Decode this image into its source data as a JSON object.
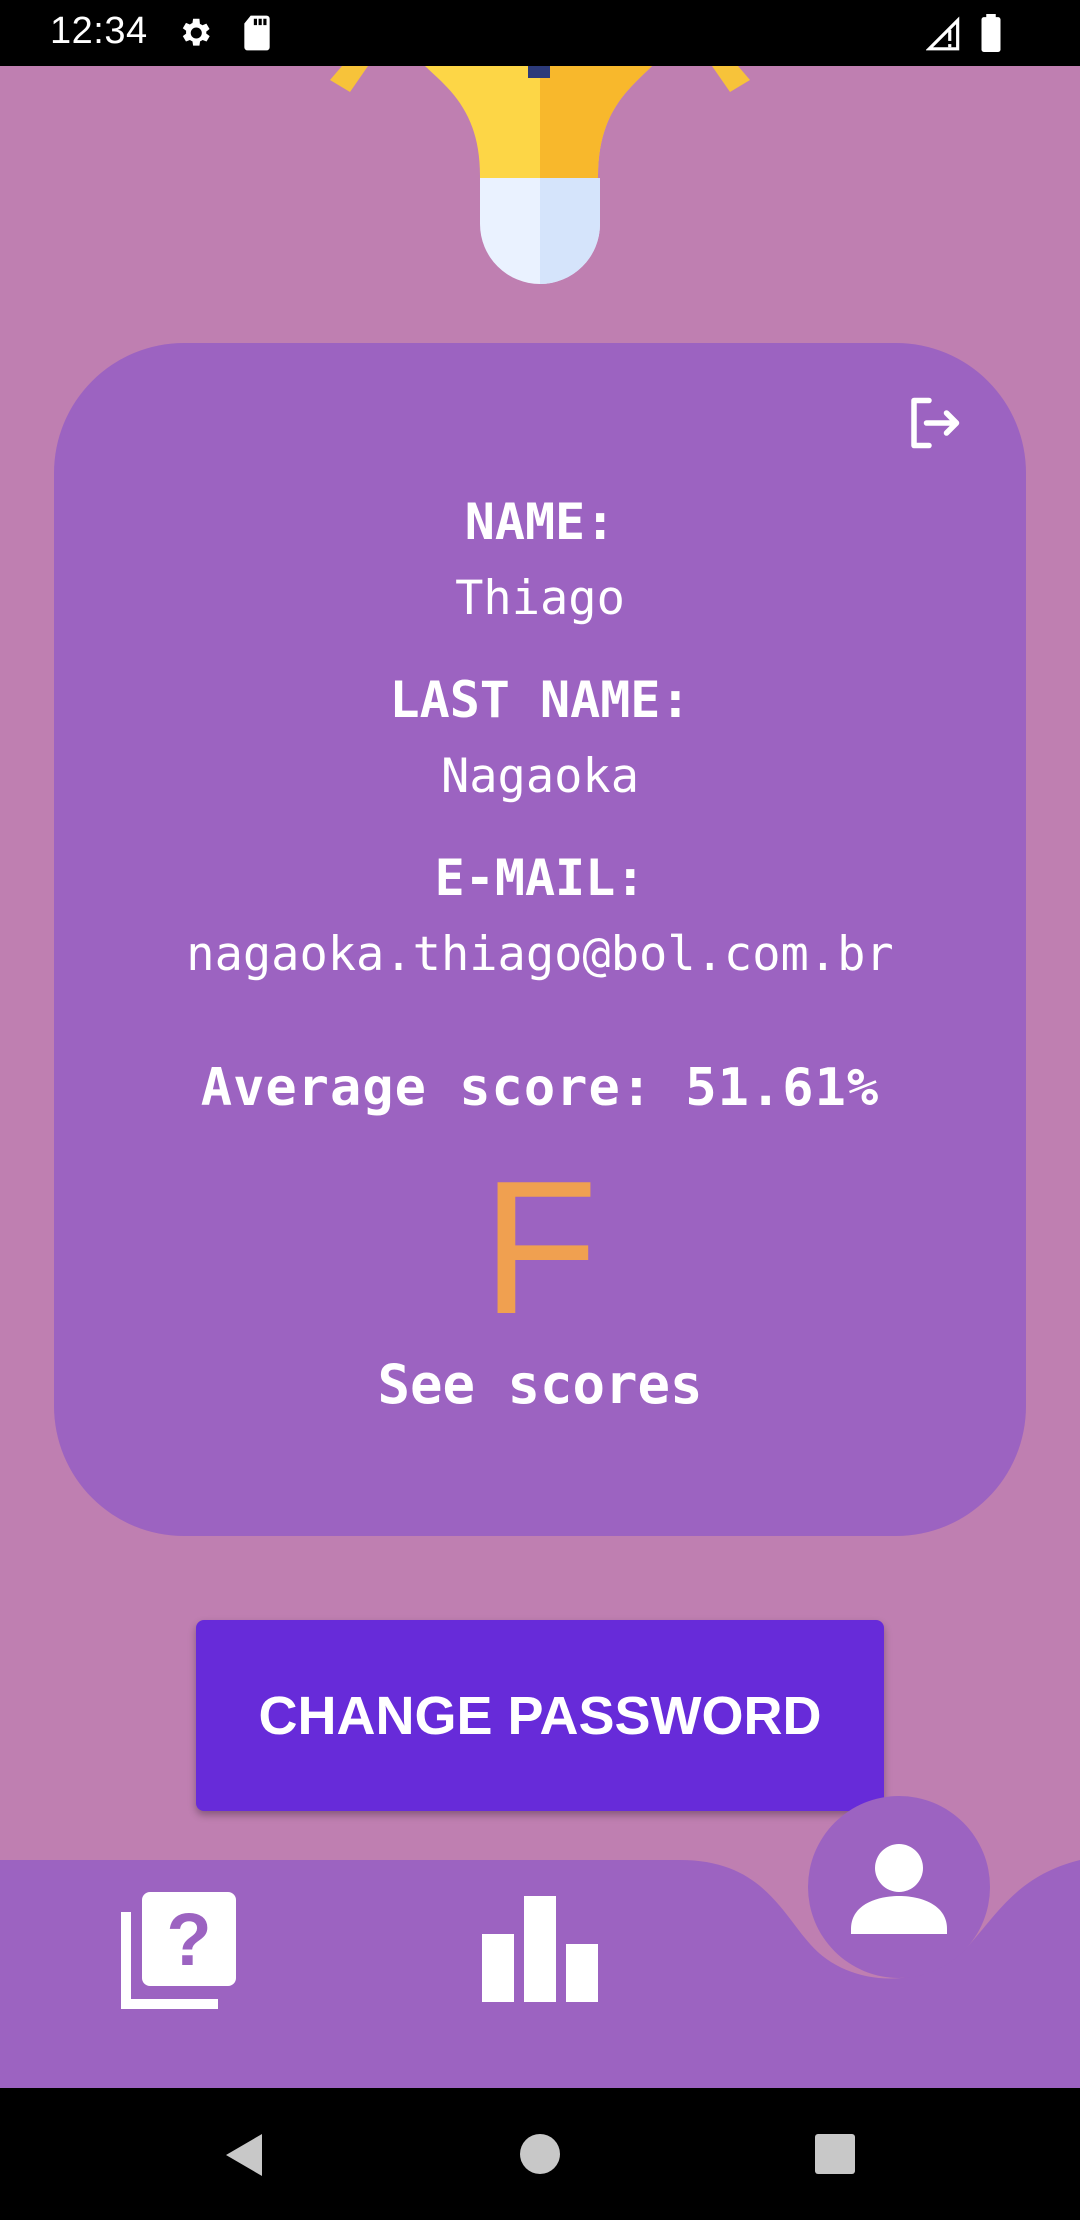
{
  "status_bar": {
    "time": "12:34"
  },
  "profile": {
    "name_label": "NAME:",
    "name_value": "Thiago",
    "last_name_label": "LAST NAME:",
    "last_name_value": "Nagaoka",
    "email_label": "E-MAIL:",
    "email_value": "nagaoka.thiago@bol.com.br",
    "average_score": "Average score: 51.61%",
    "grade": "F",
    "see_scores": "See scores"
  },
  "actions": {
    "change_password": "CHANGE PASSWORD"
  },
  "bottom_nav": {
    "items": [
      "quiz-icon",
      "bar-chart-icon",
      "person-icon"
    ],
    "active": "person-icon"
  },
  "colors": {
    "background": "#bf7fb1",
    "card": "#9c63c1",
    "button": "#672bd9",
    "grade": "#f0a050"
  }
}
